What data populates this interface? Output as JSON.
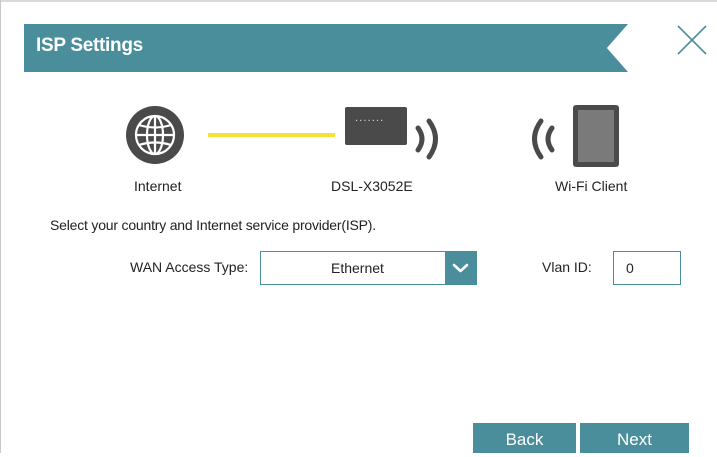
{
  "header": {
    "title": "ISP Settings"
  },
  "diagram": {
    "internet_label": "Internet",
    "router_label": "DSL-X3052E",
    "client_label": "Wi-Fi Client",
    "router_dots": "......."
  },
  "instructions": "Select your country and Internet service provider(ISP).",
  "form": {
    "wan_access_type_label": "WAN Access Type:",
    "wan_access_type_value": "Ethernet",
    "vlan_id_label": "Vlan ID:",
    "vlan_id_value": "0"
  },
  "buttons": {
    "back": "Back",
    "next": "Next"
  },
  "colors": {
    "accent": "#4a8e9c",
    "link_line": "#f5e13a",
    "device": "#4a4a4a"
  },
  "icons": [
    "globe-icon",
    "router-icon",
    "wifi-signal-icon",
    "tablet-icon",
    "close-icon",
    "chevron-down-icon"
  ]
}
